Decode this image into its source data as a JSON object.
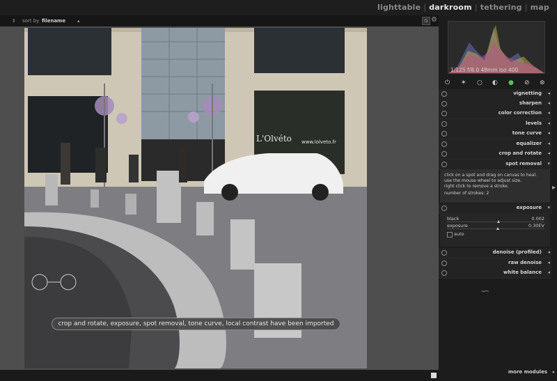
{
  "views": {
    "lighttable": "lighttable",
    "darkroom": "darkroom",
    "tethering": "tethering",
    "map": "map",
    "separator": "|"
  },
  "filmstrip": {
    "sort_label": "sort by",
    "sort_value": "filename",
    "g_button": "G"
  },
  "exif": "1/125 f/8.0 48mm iso 400",
  "modules": [
    {
      "label": "vignetting"
    },
    {
      "label": "sharpen"
    },
    {
      "label": "color correction"
    },
    {
      "label": "levels"
    },
    {
      "label": "tone curve"
    },
    {
      "label": "equalizer"
    },
    {
      "label": "crop and rotate"
    },
    {
      "label": "spot removal"
    },
    {
      "label": "exposure"
    },
    {
      "label": "denoise (profiled)"
    },
    {
      "label": "raw denoise"
    },
    {
      "label": "white balance"
    }
  ],
  "spot_removal": {
    "line1": "click on a spot and drag on canvas to heal.",
    "line2": "use the mouse wheel to adjust size.",
    "line3": "right click to remove a stroke.",
    "strokes": "number of strokes: 2"
  },
  "exposure_panel": {
    "black_label": "black",
    "black_value": "0.002",
    "exposure_label": "exposure",
    "exposure_value": "0.30EV",
    "auto_label": "auto"
  },
  "more_modules": "more modules",
  "toast": "crop and rotate, exposure, spot removal, tone curve, local contrast have been imported",
  "photo_sign": {
    "brand": "L'Olvéto",
    "url": "www.lolveto.fr"
  }
}
